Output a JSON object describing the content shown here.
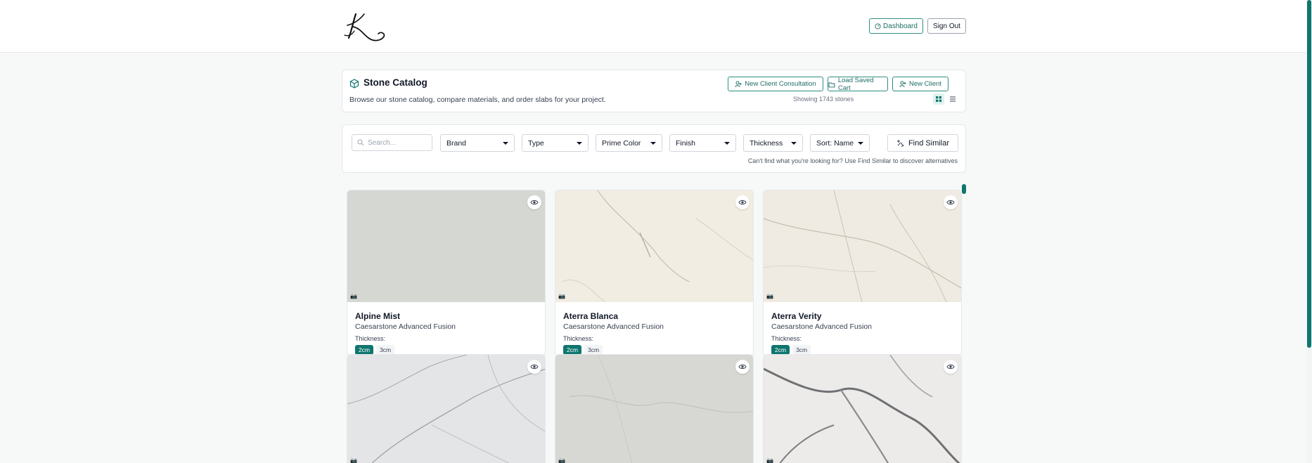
{
  "nav": {
    "dashboard_label": "Dashboard",
    "signout_label": "Sign Out"
  },
  "catalog": {
    "title": "Stone Catalog",
    "subtitle": "Browse our stone catalog, compare materials, and order slabs for your project.",
    "actions": {
      "consultation": "New Client Consultation",
      "load_cart": "Load Saved Cart",
      "new_client": "New Client"
    },
    "showing": "Showing 1743 stones"
  },
  "filters": {
    "search_placeholder": "Search...",
    "brand": "Brand",
    "type": "Type",
    "prime_color": "Prime Color",
    "finish": "Finish",
    "thickness": "Thickness",
    "sort": "Sort: Name",
    "find_similar": "Find Similar",
    "hint": "Can't find what you're looking for? Use Find Similar to discover alternatives"
  },
  "stones": [
    {
      "name": "Alpine Mist",
      "brand": "Caesarstone Advanced Fusion",
      "thickness_label": "Thickness:",
      "thicknesses": [
        "2cm",
        "3cm"
      ]
    },
    {
      "name": "Aterra Blanca",
      "brand": "Caesarstone Advanced Fusion",
      "thickness_label": "Thickness:",
      "thicknesses": [
        "2cm",
        "3cm"
      ]
    },
    {
      "name": "Aterra Verity",
      "brand": "Caesarstone Advanced Fusion",
      "thickness_label": "Thickness:",
      "thicknesses": [
        "2cm",
        "3cm"
      ]
    },
    {
      "name": "",
      "brand": "",
      "thickness_label": "",
      "thicknesses": []
    },
    {
      "name": "",
      "brand": "",
      "thickness_label": "",
      "thicknesses": []
    },
    {
      "name": "",
      "brand": "",
      "thickness_label": "",
      "thicknesses": []
    }
  ],
  "colors": {
    "accent": "#0f766e",
    "border_accent": "#2f8f83"
  },
  "icons": {
    "camera": "camera-icon",
    "eye": "eye-icon",
    "cube": "cube-icon"
  }
}
